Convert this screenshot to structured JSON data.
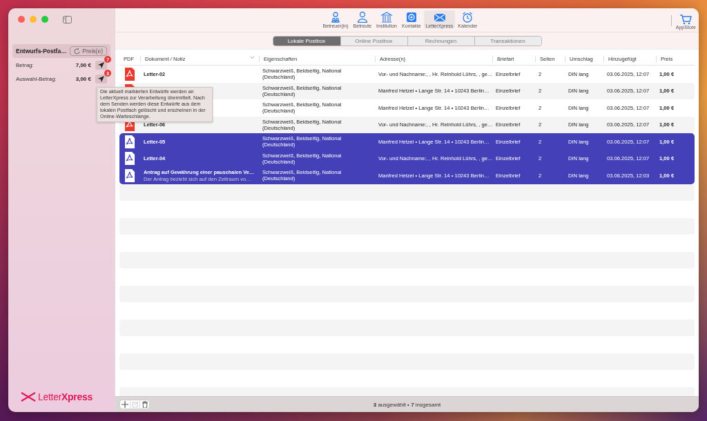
{
  "sidebar": {
    "header": {
      "title": "Entwurfs-Postfa…",
      "button": "Preis(e)"
    },
    "amounts": [
      {
        "label": "Betrag:",
        "value": "7,00 €",
        "badge": "7"
      },
      {
        "label": "Auswahl-Betrag:",
        "value": "3,00 €",
        "badge": "3"
      }
    ],
    "logo": "Letter**Xpress**"
  },
  "toolbar": {
    "items": [
      {
        "kind": "pair",
        "label": "Betreuer(in)",
        "selected": false
      },
      {
        "kind": "person",
        "label": "Betreute",
        "selected": false
      },
      {
        "kind": "building",
        "label": "Institution",
        "selected": false
      },
      {
        "kind": "at",
        "label": "Kontakte",
        "selected": false
      },
      {
        "kind": "envelope",
        "label": "LetterXpress",
        "selected": true
      },
      {
        "kind": "alarm",
        "label": "Kalender",
        "selected": false
      }
    ],
    "store": "AppStore"
  },
  "tabs": [
    {
      "label": "Lokale Postbox",
      "selected": true
    },
    {
      "label": "Online Postbox",
      "selected": false
    },
    {
      "label": "Rechnungen",
      "selected": false
    },
    {
      "label": "Transaktionen",
      "selected": false
    }
  ],
  "table": {
    "columns": [
      "PDF",
      "Dokument / Notiz",
      "Eigenschaften",
      "Adresse(n)",
      "Briefart",
      "Seiten",
      "Umschlag",
      "Hinzugefügt",
      "Preis"
    ],
    "rows": [
      {
        "name": "Letter-02",
        "pdf_icon": true,
        "properties": "Schwarzweiß, Beidseitig, National (Deutschland)",
        "address": "Vor- und Nachname:, , Hr. Reinhold Lührs, , ge…",
        "type": "Einzelbrief",
        "pages": "2",
        "envelope": "DIN lang",
        "added": "03.06.2025, 12:07",
        "price": "1,00 €",
        "selected": false
      },
      {
        "pdf_icon": true,
        "properties": "Schwarzweiß, Beidseitig, National (Deutschland)",
        "address": "Manfred Hetzel • Lange Str. 14 • 10243 Berlin…",
        "type": "Einzelbrief",
        "pages": "2",
        "envelope": "DIN lang",
        "added": "03.06.2025, 12:07",
        "price": "1,00 €",
        "selected": false
      },
      {
        "pdf_icon": false,
        "properties": "Schwarzweiß, Beidseitig, National (Deutschland)",
        "address": "Manfred Hetzel • Lange Str. 14 • 10243 Berlin…",
        "type": "Einzelbrief",
        "pages": "2",
        "envelope": "DIN lang",
        "added": "03.06.2025, 12:07",
        "price": "1,00 €",
        "selected": false
      },
      {
        "name": "Letter-06",
        "pdf_icon": true,
        "properties": "Schwarzweiß, Beidseitig, National (Deutschland)",
        "address": "Vor- und Nachname:, , Hr. Reinhold Lührs, , ge…",
        "type": "Einzelbrief",
        "pages": "2",
        "envelope": "DIN lang",
        "added": "03.06.2025, 12:07",
        "price": "1,00 €",
        "selected": false
      },
      {
        "name": "Letter-05",
        "pdf_icon": true,
        "properties": "Schwarzweiß, Beidseitig, National (Deutschland)",
        "address": "Manfred Hetzel • Lange Str. 14 • 10243 Berlin…",
        "type": "Einzelbrief",
        "pages": "2",
        "envelope": "DIN lang",
        "added": "03.06.2025, 12:07",
        "price": "1,00 €",
        "selected": true
      },
      {
        "name": "Letter-04",
        "pdf_icon": true,
        "properties": "Schwarzweiß, Beidseitig, National (Deutschland)",
        "address": "Vor- und Nachname:, , Hr. Reinhold Lührs, , ge…",
        "type": "Einzelbrief",
        "pages": "2",
        "envelope": "DIN lang",
        "added": "03.06.2025, 12:07",
        "price": "1,00 €",
        "selected": true
      },
      {
        "name": "Antrag auf Gewährung einer pauschalen Ve…",
        "pdf_icon": true,
        "note": "Der Antrag bezieht sich auf den Zeitraum vo…",
        "properties": "Schwarzweiß, Beidseitig, National (Deutschland)",
        "address": "Manfred Hetzel • Lange Str. 14 • 10243 Berlin…",
        "type": "Einzelbrief",
        "pages": "2",
        "envelope": "DIN lang",
        "added": "03.06.2025, 12:03",
        "price": "1,00 €",
        "selected": true
      }
    ]
  },
  "bottom_bar": {
    "buttons": [
      {
        "kind": "add",
        "disabled": false
      },
      {
        "kind": "edit",
        "disabled": true
      },
      {
        "kind": "delete",
        "disabled": false
      }
    ],
    "status": "**3** ausgewählt • **7** insgesamt"
  },
  "tooltip": "Die aktuell markierten Entwürfe werden an LetterXpress zur Verarbeitung übermittelt. Nach dem Senden werden diese Entwürfe aus dem lokalen Postfach gelöscht und erscheinen in der Online-Warteschlange."
}
